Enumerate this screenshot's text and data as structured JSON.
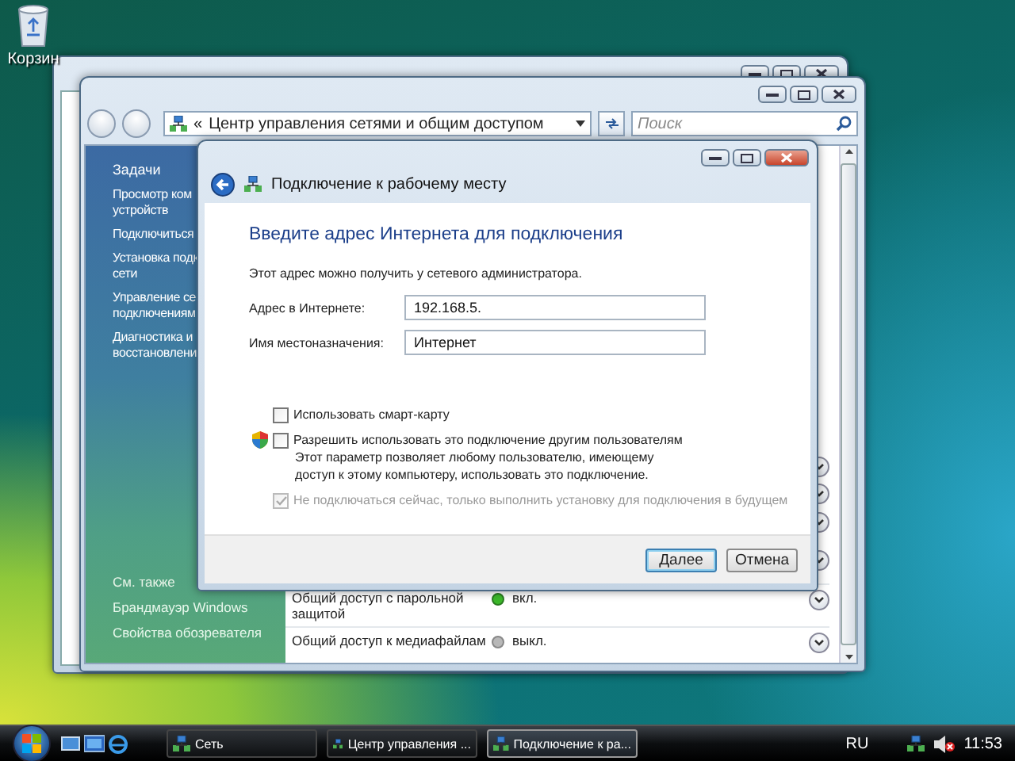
{
  "desktop_icons": [
    {
      "label": "Корзин"
    }
  ],
  "network_center": {
    "address_prefix": "«",
    "address": "Центр управления сетями и общим доступом",
    "search": {
      "placeholder": "Поиск"
    },
    "tasks": {
      "title": "Задачи",
      "items": [
        {
          "lines": [
            "Просмотр ком",
            "устройств"
          ]
        },
        {
          "lines": [
            "Подключиться"
          ]
        },
        {
          "lines": [
            "Установка подк",
            "сети"
          ]
        },
        {
          "lines": [
            "Управление се",
            "подключениям"
          ]
        },
        {
          "lines": [
            "Диагностика и",
            "восстановлени"
          ]
        }
      ]
    },
    "see_also": {
      "title": "См. также",
      "items": [
        "Брандмауэр Windows",
        "Свойства обозревателя"
      ]
    },
    "sharing_rows": [
      {
        "label": "Общий доступ с парольной защитой",
        "status": "вкл.",
        "on": true
      },
      {
        "label": "Общий доступ к медиафайлам",
        "status": "выкл.",
        "on": false
      }
    ]
  },
  "dialog": {
    "title": "Подключение к рабочему месту",
    "heading": "Введите адрес Интернета для подключения",
    "hint": "Этот адрес можно получить у сетевого администратора.",
    "fields": [
      {
        "label": "Адрес в Интернете:",
        "value": "192.168.5."
      },
      {
        "label": "Имя местоназначения:",
        "value": "Интернет"
      }
    ],
    "options": [
      {
        "label": "Использовать смарт-карту",
        "checked": false,
        "disabled": false,
        "shield": false
      },
      {
        "label": "Разрешить использовать это подключение другим пользователям",
        "checked": false,
        "disabled": false,
        "shield": true,
        "description": "Этот параметр позволяет любому пользователю, имеющему доступ к этому компьютеру, использовать это подключение."
      },
      {
        "label": "Не подключаться сейчас, только выполнить установку для подключения в будущем",
        "checked": true,
        "disabled": true,
        "shield": false
      }
    ],
    "buttons": [
      {
        "label": "Далее",
        "default": true
      },
      {
        "label": "Отмена",
        "default": false
      }
    ]
  },
  "taskbar": {
    "buttons": [
      {
        "label": "Сеть",
        "selected": false
      },
      {
        "label": "Центр управления ...",
        "selected": false
      },
      {
        "label": "Подключение к ра...",
        "selected": true
      }
    ],
    "language": "RU",
    "volume_muted": true,
    "clock": "11:53"
  }
}
